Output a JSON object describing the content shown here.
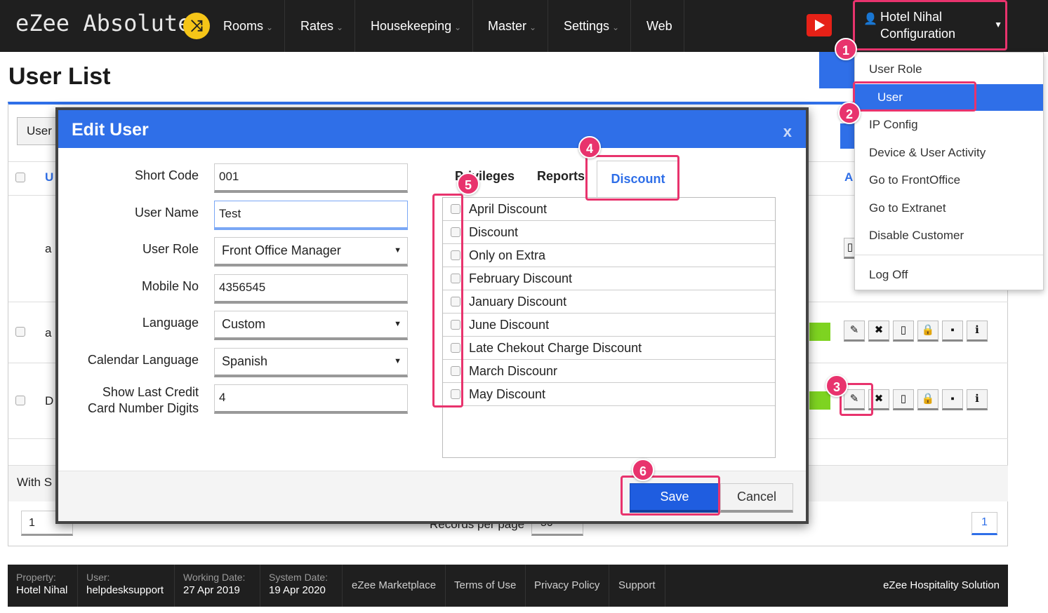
{
  "app": {
    "logo": "eZee Absolute",
    "logo_badge": "⤨"
  },
  "nav": {
    "items": [
      {
        "label": "Rooms",
        "caret": "⌄"
      },
      {
        "label": "Rates",
        "caret": "⌄"
      },
      {
        "label": "Housekeeping",
        "caret": "⌄"
      },
      {
        "label": "Master",
        "caret": "⌄"
      },
      {
        "label": "Settings",
        "caret": "⌄"
      },
      {
        "label": "Web",
        "caret": ""
      }
    ],
    "hotel_line1": "Hotel Nihal",
    "hotel_line2": "Configuration",
    "user_icon": "👤",
    "dropdown_caret": "▼"
  },
  "page": {
    "title": "User List",
    "user_tab": "User",
    "frags": [
      "U",
      "A",
      "a",
      "a",
      "D",
      "With S",
      "1",
      "Records per page",
      "50",
      "1"
    ]
  },
  "dropdown": {
    "items": [
      "User Role",
      "User",
      "IP Config",
      "Device & User Activity",
      "Go to FrontOffice",
      "Go to Extranet",
      "Disable Customer"
    ],
    "logoff": "Log Off"
  },
  "modal": {
    "title": "Edit User",
    "close": "x",
    "fields": {
      "short_code_label": "Short Code",
      "short_code": "001",
      "user_name_label": "User Name",
      "user_name": "Test",
      "user_role_label": "User Role",
      "user_role": "Front Office Manager",
      "mobile_label": "Mobile No",
      "mobile": "4356545",
      "language_label": "Language",
      "language": "Custom",
      "calendar_label": "Calendar Language",
      "calendar": "Spanish",
      "card_label_1": "Show Last Credit",
      "card_label_2": "Card Number Digits",
      "card_digits": "4"
    },
    "tabs": [
      "Privileges",
      "Reports",
      "Discount"
    ],
    "discounts": [
      "April Discount",
      "Discount",
      "Only on Extra",
      "February Discount",
      "January Discount",
      "June Discount",
      "Late Chekout Charge Discount",
      "March Discounr",
      "May Discount"
    ],
    "save": "Save",
    "cancel": "Cancel"
  },
  "actions": {
    "edit": "✎",
    "delete": "✖",
    "device": "▯",
    "lock": "🔒",
    "message": "▪",
    "info": "ℹ"
  },
  "statusbar": {
    "property_label": "Property:",
    "property": "Hotel Nihal",
    "user_label": "User:",
    "user": "helpdesksupport",
    "working_label": "Working Date:",
    "working": "27 Apr 2019",
    "system_label": "System Date:",
    "system": "19 Apr 2020",
    "links": [
      "eZee Marketplace",
      "Terms of Use",
      "Privacy Policy",
      "Support"
    ],
    "brand": "eZee Hospitality Solution"
  },
  "annotations": [
    "1",
    "2",
    "3",
    "4",
    "5",
    "6"
  ],
  "colors": {
    "accent": "#2f6fe8",
    "highlight": "#e8336d",
    "nav_bg": "#1f1f1f",
    "active_green": "#7ed321"
  }
}
